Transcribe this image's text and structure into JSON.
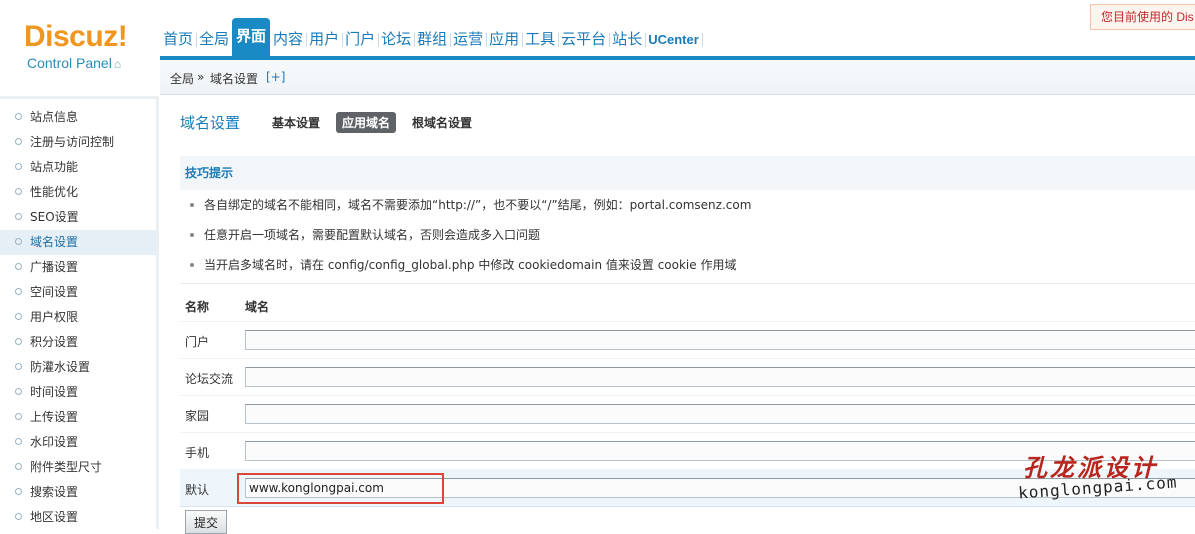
{
  "logo": {
    "wordmark": "Discuz!",
    "subtitle": "Control Panel"
  },
  "notice": "您目前使用的 Dis",
  "topnav": [
    {
      "label": "首页",
      "active": false
    },
    {
      "label": "全局",
      "active": false
    },
    {
      "label": "界面",
      "active": true
    },
    {
      "label": "内容",
      "active": false
    },
    {
      "label": "用户",
      "active": false
    },
    {
      "label": "门户",
      "active": false
    },
    {
      "label": "论坛",
      "active": false
    },
    {
      "label": "群组",
      "active": false
    },
    {
      "label": "运营",
      "active": false
    },
    {
      "label": "应用",
      "active": false
    },
    {
      "label": "工具",
      "active": false
    },
    {
      "label": "云平台",
      "active": false
    },
    {
      "label": "站长",
      "active": false
    },
    {
      "label": "UCenter",
      "active": false
    }
  ],
  "breadcrumb": {
    "root": "全局",
    "sep": "»",
    "current": "域名设置",
    "add": "[+]"
  },
  "sidebar": [
    {
      "label": "站点信息",
      "active": false
    },
    {
      "label": "注册与访问控制",
      "active": false
    },
    {
      "label": "站点功能",
      "active": false
    },
    {
      "label": "性能优化",
      "active": false
    },
    {
      "label": "SEO设置",
      "active": false
    },
    {
      "label": "域名设置",
      "active": true
    },
    {
      "label": "广播设置",
      "active": false
    },
    {
      "label": "空间设置",
      "active": false
    },
    {
      "label": "用户权限",
      "active": false
    },
    {
      "label": "积分设置",
      "active": false
    },
    {
      "label": "防灌水设置",
      "active": false
    },
    {
      "label": "时间设置",
      "active": false
    },
    {
      "label": "上传设置",
      "active": false
    },
    {
      "label": "水印设置",
      "active": false
    },
    {
      "label": "附件类型尺寸",
      "active": false
    },
    {
      "label": "搜索设置",
      "active": false
    },
    {
      "label": "地区设置",
      "active": false
    }
  ],
  "page": {
    "title": "域名设置",
    "tabs": [
      {
        "label": "基本设置",
        "active": false
      },
      {
        "label": "应用域名",
        "active": true
      },
      {
        "label": "根域名设置",
        "active": false
      }
    ]
  },
  "tips": {
    "heading": "技巧提示",
    "items": [
      "各自绑定的域名不能相同，域名不需要添加“http://”，也不要以“/”结尾，例如：portal.comsenz.com",
      "任意开启一项域名，需要配置默认域名，否则会造成多入口问题",
      "当开启多域名时，请在 config/config_global.php 中修改 cookiedomain 值来设置 cookie 作用域"
    ]
  },
  "table": {
    "col_name": "名称",
    "col_domain": "域名",
    "rows": [
      {
        "name": "门户",
        "value": ""
      },
      {
        "name": "论坛交流",
        "value": ""
      },
      {
        "name": "家园",
        "value": ""
      },
      {
        "name": "手机",
        "value": ""
      },
      {
        "name": "默认",
        "value": "www.konglongpai.com"
      }
    ]
  },
  "submit_label": "提交",
  "watermark": {
    "line1": "孔龙派设计",
    "line2": "konglongpai.com"
  }
}
